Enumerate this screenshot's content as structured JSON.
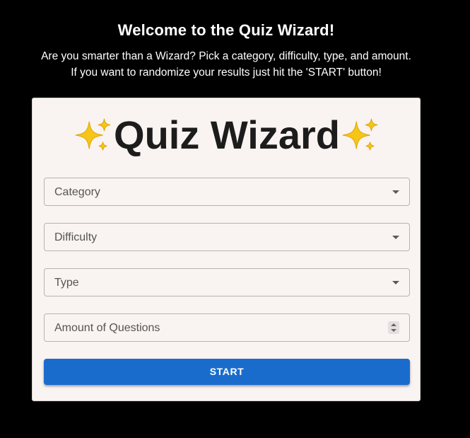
{
  "header": {
    "title": "Welcome to the Quiz Wizard!",
    "line1": "Are you smarter than a Wizard? Pick a category, difficulty, type, and amount.",
    "line2": "If you want to randomize your results just hit the 'START' button!"
  },
  "card": {
    "title": "Quiz Wizard",
    "title_icon": "sparkles-icon",
    "fields": [
      {
        "label": "Category",
        "kind": "select",
        "icon": "chevron-down-icon"
      },
      {
        "label": "Difficulty",
        "kind": "select",
        "icon": "chevron-down-icon"
      },
      {
        "label": "Type",
        "kind": "select",
        "icon": "chevron-down-icon"
      },
      {
        "label": "Amount of Questions",
        "kind": "number",
        "icon": "spinner-icon"
      }
    ],
    "start_label": "START"
  },
  "colors": {
    "background": "#000000",
    "card": "#f9f3f1",
    "button": "#1a6ccc",
    "sparkle": "#f5c518"
  }
}
